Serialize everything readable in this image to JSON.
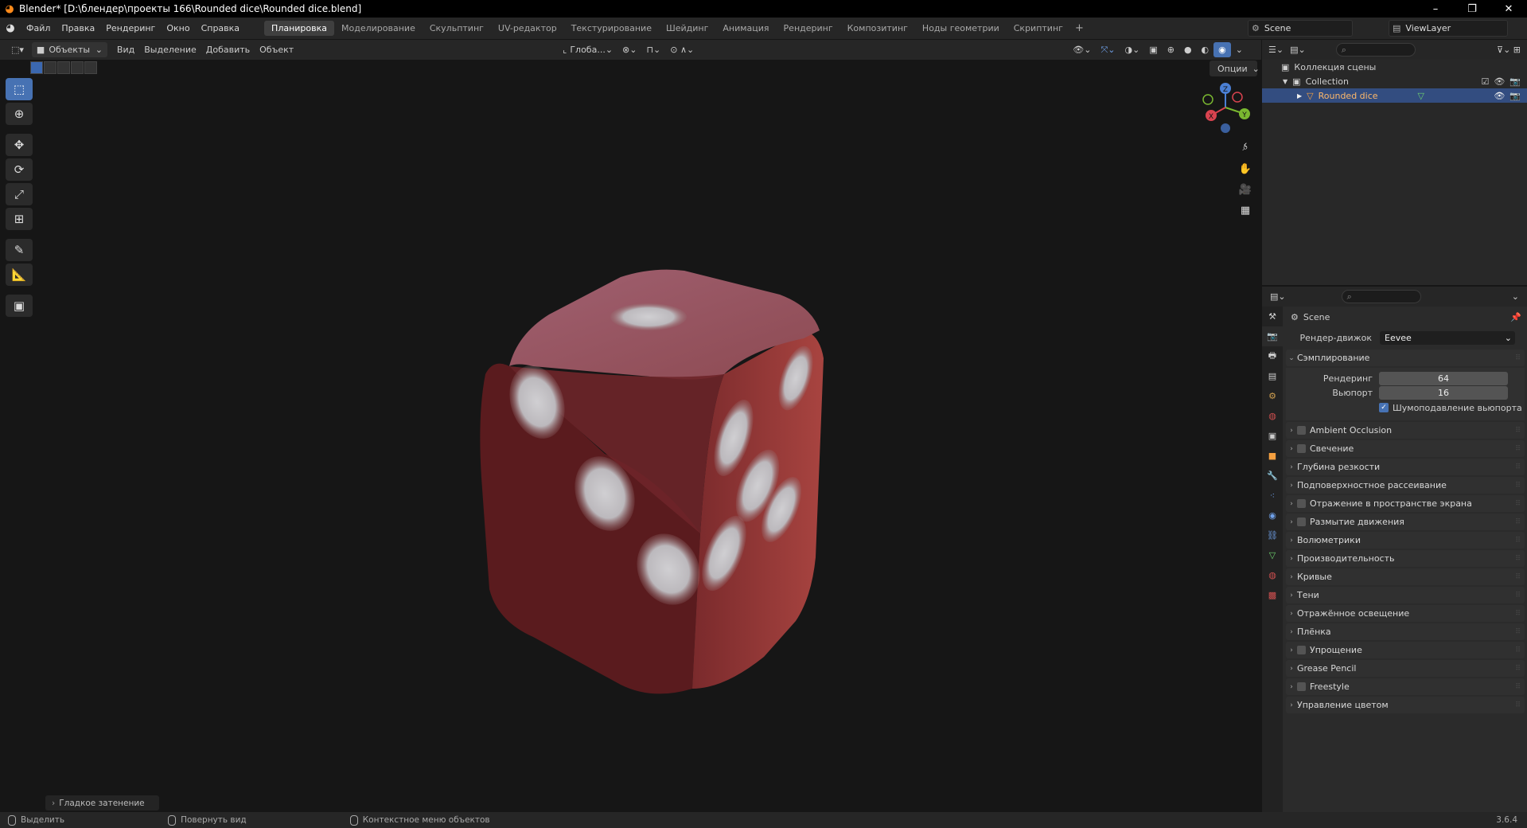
{
  "window": {
    "title": "Blender* [D:\\блендер\\проекты 166\\Rounded dice\\Rounded dice.blend]",
    "controls": [
      "–",
      "❐",
      "✕"
    ]
  },
  "menu": {
    "items": [
      "Файл",
      "Правка",
      "Рендеринг",
      "Окно",
      "Справка"
    ]
  },
  "workspaces": {
    "tabs": [
      "Планировка",
      "Моделирование",
      "Скульптинг",
      "UV-редактор",
      "Текстурирование",
      "Шейдинг",
      "Анимация",
      "Рендеринг",
      "Композитинг",
      "Ноды геометрии",
      "Скриптинг"
    ],
    "active": "Планировка",
    "add": "+"
  },
  "scene": {
    "name": "Scene",
    "view_layer": "ViewLayer"
  },
  "viewport_header": {
    "mode": "Объекты",
    "menus": [
      "Вид",
      "Выделение",
      "Добавить",
      "Объект"
    ],
    "orientation": "Глоба...",
    "options": "Опции"
  },
  "toolbar": {
    "tools": [
      "select-box",
      "cursor",
      "move",
      "rotate",
      "scale",
      "transform",
      "annotate",
      "measure",
      "add-cube"
    ]
  },
  "gizmo": {
    "axes": [
      "X",
      "Y",
      "Z"
    ]
  },
  "last_operator": "Гладкое затенение",
  "statusbar": {
    "select": "Выделить",
    "rotate_view": "Повернуть вид",
    "context_menu": "Контекстное меню объектов",
    "version": "3.6.4"
  },
  "outliner": {
    "scene_collection": "Коллекция сцены",
    "collection": "Collection",
    "object": "Rounded dice"
  },
  "properties": {
    "scene_label": "Scene",
    "render_engine_label": "Рендер-движок",
    "render_engine": "Eevee",
    "sampling": {
      "title": "Сэмплирование",
      "render_label": "Рендеринг",
      "render_value": "64",
      "viewport_label": "Вьюпорт",
      "viewport_value": "16",
      "denoise_label": "Шумоподавление вьюпорта",
      "denoise_checked": true
    },
    "panels": [
      {
        "label": "Ambient Occlusion",
        "checkbox": true
      },
      {
        "label": "Свечение",
        "checkbox": true
      },
      {
        "label": "Глубина резкости",
        "checkbox": false
      },
      {
        "label": "Подповерхностное рассеивание",
        "checkbox": false
      },
      {
        "label": "Отражение в пространстве экрана",
        "checkbox": true
      },
      {
        "label": "Размытие движения",
        "checkbox": true
      },
      {
        "label": "Волюметрики",
        "checkbox": false
      },
      {
        "label": "Производительность",
        "checkbox": false
      },
      {
        "label": "Кривые",
        "checkbox": false
      },
      {
        "label": "Тени",
        "checkbox": false
      },
      {
        "label": "Отражённое освещение",
        "checkbox": false
      },
      {
        "label": "Плёнка",
        "checkbox": false
      },
      {
        "label": "Упрощение",
        "checkbox": true
      },
      {
        "label": "Grease Pencil",
        "checkbox": false
      },
      {
        "label": "Freestyle",
        "checkbox": true
      },
      {
        "label": "Управление цветом",
        "checkbox": false
      }
    ]
  },
  "colors": {
    "accent": "#4772b3",
    "dice": "#8a2f2f",
    "selection": "#334d80"
  }
}
